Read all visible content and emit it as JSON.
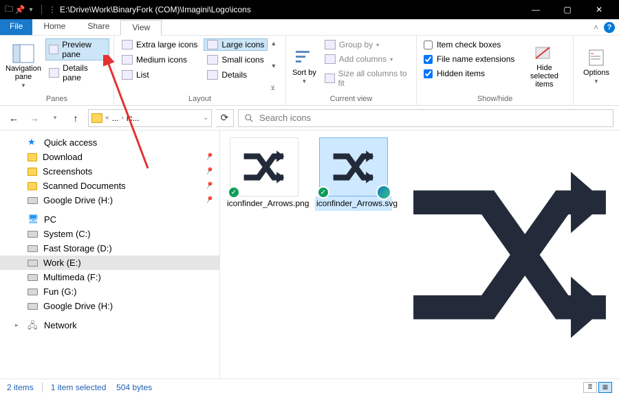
{
  "titlebar": {
    "path": "E:\\Drive\\Work\\BinaryFork (COM)\\Imagini\\Logo\\icons"
  },
  "menu": {
    "file": "File",
    "home": "Home",
    "share": "Share",
    "view": "View"
  },
  "ribbon": {
    "panes": {
      "navigation": "Navigation pane",
      "preview": "Preview pane",
      "details": "Details pane",
      "label": "Panes"
    },
    "layout": {
      "xl": "Extra large icons",
      "large": "Large icons",
      "medium": "Medium icons",
      "small": "Small icons",
      "list": "List",
      "details": "Details",
      "label": "Layout"
    },
    "currentview": {
      "sortby": "Sort by",
      "groupby": "Group by",
      "addcols": "Add columns",
      "sizecols": "Size all columns to fit",
      "label": "Current view"
    },
    "showhide": {
      "itemcheck": "Item check boxes",
      "ext": "File name extensions",
      "hidden": "Hidden items",
      "hidesel": "Hide selected items",
      "label": "Show/hide"
    },
    "options": "Options"
  },
  "addr": {
    "part1": "...",
    "part2": "ic...",
    "search_placeholder": "Search icons"
  },
  "sidebar": {
    "quick": "Quick access",
    "items_quick": [
      {
        "label": "Download",
        "icon": "fold",
        "pin": true
      },
      {
        "label": "Screenshots",
        "icon": "fold",
        "pin": true
      },
      {
        "label": "Scanned Documents",
        "icon": "fold",
        "pin": true
      },
      {
        "label": "Google Drive (H:)",
        "icon": "drive",
        "pin": true
      }
    ],
    "pc": "PC",
    "items_pc": [
      {
        "label": "System (C:)",
        "icon": "drive"
      },
      {
        "label": "Fast Storage (D:)",
        "icon": "drive"
      },
      {
        "label": "Work (E:)",
        "icon": "drive",
        "sel": true
      },
      {
        "label": "Multimeda (F:)",
        "icon": "drive"
      },
      {
        "label": "Fun (G:)",
        "icon": "drive"
      },
      {
        "label": "Google Drive (H:)",
        "icon": "drive"
      }
    ],
    "network": "Network"
  },
  "files": [
    {
      "name": "iconfinder_Arrows.png",
      "sel": false,
      "edge": false
    },
    {
      "name": "iconfinder_Arrows.svg",
      "sel": true,
      "edge": true
    }
  ],
  "status": {
    "count": "2 items",
    "sel": "1 item selected",
    "size": "504 bytes"
  }
}
